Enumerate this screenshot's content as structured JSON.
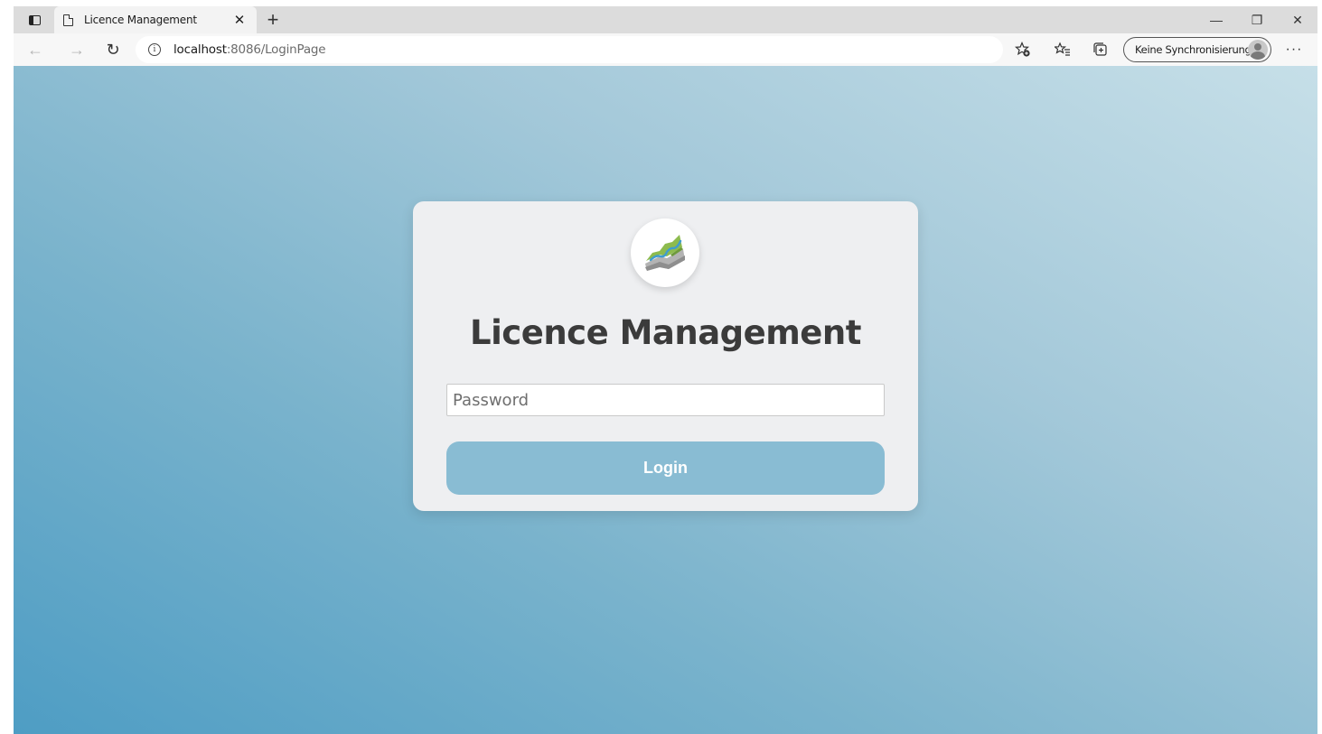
{
  "browser": {
    "tab": {
      "title": "Licence Management",
      "close_glyph": "✕"
    },
    "new_tab_glyph": "+",
    "window_controls": {
      "minimize": "—",
      "restore": "❐",
      "close": "✕"
    },
    "nav": {
      "back": "←",
      "forward": "→",
      "reload": "↻"
    },
    "address": {
      "host": "localhost",
      "rest": ":8086/LoginPage"
    },
    "sync": {
      "label": "Keine Synchronisierung"
    },
    "more": "···",
    "icons": [
      "tab-actions-icon",
      "page-icon",
      "info-icon",
      "add-favorite-icon",
      "favorites-icon",
      "collections-icon",
      "profile-avatar-icon"
    ]
  },
  "login": {
    "title": "Licence Management",
    "password_placeholder": "Password",
    "password_value": "",
    "button_label": "Login",
    "colors": {
      "card": "#eeeff1",
      "button": "#89bcd3",
      "title": "#3b3b3b",
      "logo_green": "#8dbb4e",
      "logo_blue": "#3f9ccf",
      "logo_gray": "#a9a9a9"
    }
  }
}
